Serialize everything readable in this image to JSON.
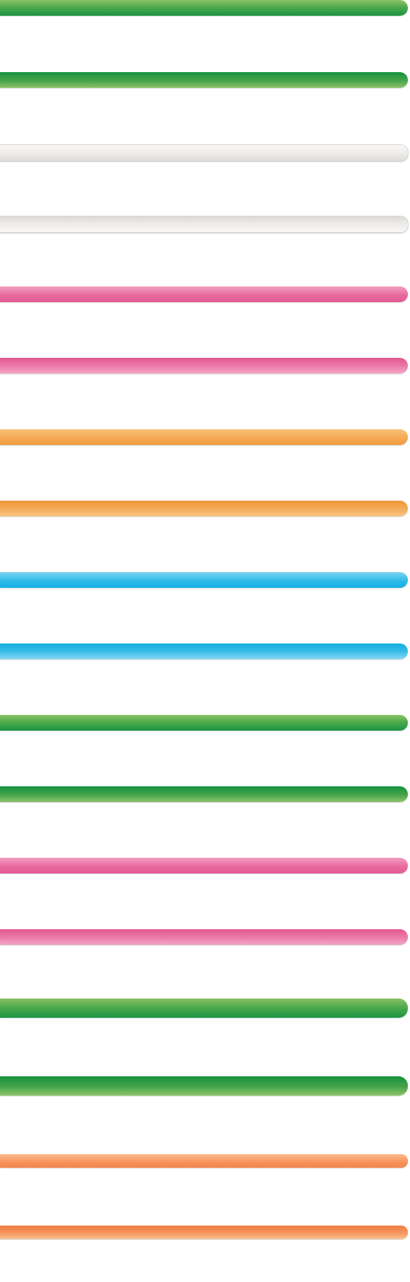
{
  "bars": [
    {
      "style": "green",
      "shading": "light-top",
      "color": "#4faa4c"
    },
    {
      "style": "green",
      "shading": "dark-top",
      "color": "#47a54a"
    },
    {
      "style": "gray",
      "shading": "light-top",
      "color": "#ecebe8"
    },
    {
      "style": "gray",
      "shading": "dark-top",
      "color": "#ecebe8"
    },
    {
      "style": "pink",
      "shading": "light-top",
      "color": "#e86b9f"
    },
    {
      "style": "pink",
      "shading": "dark-top",
      "color": "#ea78a8"
    },
    {
      "style": "orange",
      "shading": "light-top",
      "color": "#f5a954"
    },
    {
      "style": "orange",
      "shading": "dark-top",
      "color": "#f4aa57"
    },
    {
      "style": "blue",
      "shading": "light-top",
      "color": "#2fbbe8"
    },
    {
      "style": "blue",
      "shading": "dark-top",
      "color": "#37bde9"
    },
    {
      "style": "green",
      "shading": "light-top",
      "color": "#4faa4c"
    },
    {
      "style": "green",
      "shading": "dark-top",
      "color": "#47a54a"
    },
    {
      "style": "pink",
      "shading": "light-top",
      "color": "#e86b9f"
    },
    {
      "style": "pink",
      "shading": "dark-top",
      "color": "#ea78a8"
    },
    {
      "style": "green-thick",
      "shading": "light-top",
      "color": "#4faa4c"
    },
    {
      "style": "green-thick",
      "shading": "dark-top",
      "color": "#47a54a"
    },
    {
      "style": "orange-red",
      "shading": "light-top",
      "color": "#f6955c"
    },
    {
      "style": "orange-red",
      "shading": "dark-top",
      "color": "#f5935a"
    }
  ]
}
